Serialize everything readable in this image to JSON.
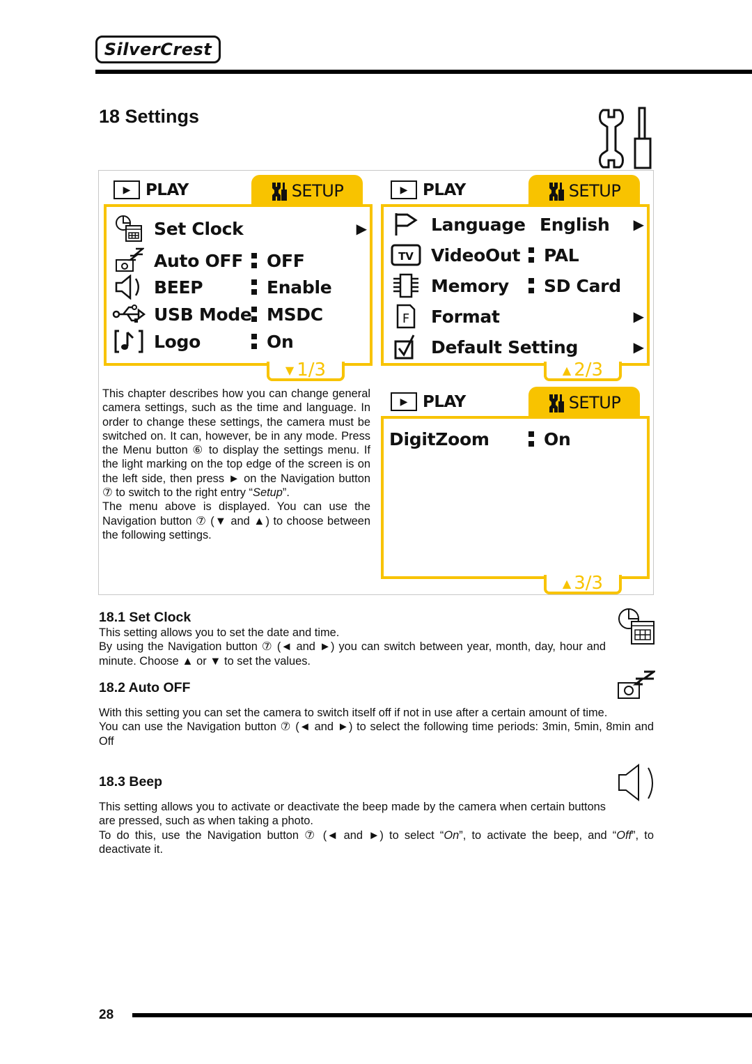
{
  "header": {
    "brand": "SilverCrest",
    "chapter_title": "18 Settings"
  },
  "screens": [
    {
      "tab_play": "PLAY",
      "tab_setup": "SETUP",
      "page": "1/3",
      "page_arrow": "▼",
      "rows": [
        {
          "icon": "clock-calendar-icon",
          "label": "Set Clock",
          "value": "",
          "arrow": "▶"
        },
        {
          "icon": "camera-sleep-icon",
          "label": "Auto OFF",
          "value": "OFF",
          "arrow": ""
        },
        {
          "icon": "speaker-icon",
          "label": "BEEP",
          "value": "Enable",
          "arrow": ""
        },
        {
          "icon": "usb-icon",
          "label": "USB Mode",
          "value": "MSDC",
          "arrow": ""
        },
        {
          "icon": "music-note-icon",
          "label": "Logo",
          "value": "On",
          "arrow": ""
        }
      ]
    },
    {
      "tab_play": "PLAY",
      "tab_setup": "SETUP",
      "page": "2/3",
      "page_arrow": "▲",
      "rows": [
        {
          "icon": "flag-icon",
          "label": "Language",
          "value": "English",
          "arrow": "▶"
        },
        {
          "icon": "tv-icon",
          "label": "VideoOut",
          "value": "PAL",
          "arrow": ""
        },
        {
          "icon": "memory-chip-icon",
          "label": "Memory",
          "value": "SD Card",
          "arrow": ""
        },
        {
          "icon": "format-icon",
          "label": "Format",
          "value": "",
          "arrow": "▶"
        },
        {
          "icon": "checkbox-icon",
          "label": "Default Setting",
          "value": "",
          "arrow": "▶"
        }
      ]
    },
    {
      "tab_play": "PLAY",
      "tab_setup": "SETUP",
      "page": "3/3",
      "page_arrow": "▲",
      "rows": [
        {
          "icon": "",
          "label": "DigitZoom",
          "value": "On",
          "arrow": ""
        }
      ]
    }
  ],
  "intro": {
    "p1": "This chapter describes how you can change general camera settings, such as the time and language. In order to change these settings, the camera must be switched on. It can, however, be in any mode. Press the Menu button ⑥ to display the settings menu. If the light marking on the top edge of the screen is on the left side, then press ► on the Navigation button ⑦ to switch to the right entry “",
    "p1_em": "Setup",
    "p1_end": "”.",
    "p2": "The menu above is displayed. You can use the Navigation button ⑦ (▼ and ▲) to choose between the following settings."
  },
  "sections": [
    {
      "title": "18.1  Set Clock",
      "paragraphs": [
        "This setting allows you to set the date and time.",
        "By using the Navigation button ⑦ (◄ and ►) you can switch between year, month, day, hour and minute. Choose ▲ or ▼ to set the values."
      ]
    },
    {
      "title": "18.2  Auto OFF",
      "paragraphs": [
        "With this setting you can set the camera to switch itself off if not in use after a certain amount of time.",
        "You can use the Navigation button ⑦ (◄ and ►) to select the following time periods: 3min, 5min, 8min and Off"
      ]
    },
    {
      "title": "18.3  Beep",
      "paragraphs": [
        "This setting allows you to activate or deactivate the beep made by the camera when certain buttons are pressed, such as when taking a photo.",
        "To do this, use the Navigation button ⑦ (◄ and ►) to select “",
        "On",
        "”, to activate the beep, and “",
        "Off",
        "”, to deactivate it."
      ]
    }
  ],
  "footer": {
    "page_number": "28"
  },
  "colors": {
    "accent_yellow": "#F8C300",
    "text": "#111111"
  }
}
